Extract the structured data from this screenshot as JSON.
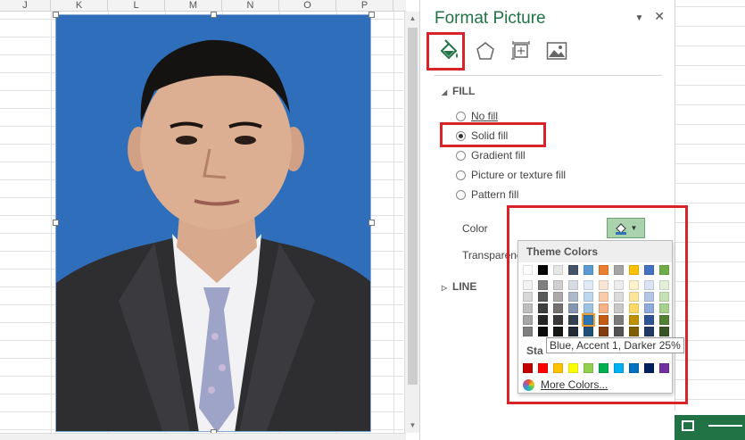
{
  "sheet": {
    "columns": [
      "J",
      "K",
      "L",
      "M",
      "N",
      "O",
      "P"
    ]
  },
  "pane": {
    "title": "Format Picture",
    "pin_symbol": "▼",
    "close_symbol": "✕",
    "tabs": [
      {
        "name": "fill-line-tab",
        "icon": "paint-bucket-icon",
        "active": true
      },
      {
        "name": "effects-tab",
        "icon": "pentagon-icon",
        "active": false
      },
      {
        "name": "size-properties-tab",
        "icon": "size-properties-icon",
        "active": false
      },
      {
        "name": "picture-tab",
        "icon": "picture-icon",
        "active": false
      }
    ],
    "fill": {
      "heading": "FILL",
      "options": [
        {
          "label": "No fill",
          "selected": false
        },
        {
          "label": "Solid fill",
          "selected": true
        },
        {
          "label": "Gradient fill",
          "selected": false
        },
        {
          "label": "Picture or texture fill",
          "selected": false
        },
        {
          "label": "Pattern fill",
          "selected": false
        }
      ],
      "color_label": "Color",
      "transparency_label": "Transparenc"
    },
    "line": {
      "heading": "LINE"
    }
  },
  "palette": {
    "theme_heading": "Theme Colors",
    "standard_heading": "Sta",
    "tooltip": "Blue, Accent 1, Darker 25%",
    "more_colors": "More Colors...",
    "theme_top": [
      "#ffffff",
      "#000000",
      "#e7e6e6",
      "#44546a",
      "#5b9bd5",
      "#ed7d31",
      "#a5a5a5",
      "#ffc000",
      "#4472c4",
      "#70ad47"
    ],
    "theme_shades": [
      [
        "#f2f2f2",
        "#7f7f7f",
        "#d0cece",
        "#d6dce4",
        "#deebf6",
        "#fbe5d5",
        "#ededed",
        "#fff2cc",
        "#dae3f3",
        "#e2efd9"
      ],
      [
        "#d8d8d8",
        "#595959",
        "#aeaaaa",
        "#adb9ca",
        "#bdd7ee",
        "#f7cbac",
        "#dbdbdb",
        "#fee599",
        "#b4c6e7",
        "#c5e0b3"
      ],
      [
        "#bfbfbf",
        "#3f3f3f",
        "#757070",
        "#8496b0",
        "#9cc3e5",
        "#f4b183",
        "#c9c9c9",
        "#ffd965",
        "#8eaadb",
        "#a8d08d"
      ],
      [
        "#a5a5a5",
        "#262626",
        "#3a3838",
        "#323f4f",
        "#2e75b5",
        "#c55a11",
        "#7b7b7b",
        "#bf9000",
        "#2f5496",
        "#538135"
      ],
      [
        "#7f7f7f",
        "#0c0c0c",
        "#171616",
        "#222a35",
        "#1f4e79",
        "#833c0b",
        "#525252",
        "#7f6000",
        "#1f3864",
        "#375623"
      ]
    ],
    "standard": [
      "#c00000",
      "#ff0000",
      "#ffc000",
      "#ffff00",
      "#92d050",
      "#00b050",
      "#00b0f0",
      "#0070c0",
      "#002060",
      "#7030a0"
    ],
    "selected_swatch": "Blue, Accent 1, Darker 25%"
  }
}
